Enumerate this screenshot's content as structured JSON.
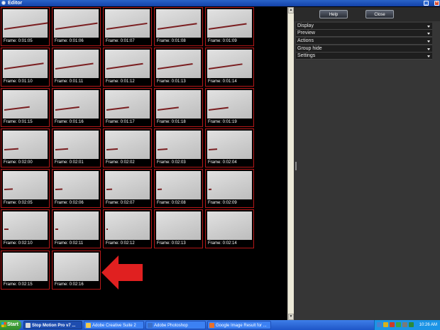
{
  "window": {
    "title": "Editor",
    "controls": {
      "minimize": "_",
      "maximize": "□",
      "close": "×"
    }
  },
  "frames": [
    {
      "label": "Frame: 0:01:05"
    },
    {
      "label": "Frame: 0:01:06"
    },
    {
      "label": "Frame: 0:01:07"
    },
    {
      "label": "Frame: 0:01:08"
    },
    {
      "label": "Frame: 0:01:09"
    },
    {
      "label": "Frame: 0:01:10"
    },
    {
      "label": "Frame: 0:01:11"
    },
    {
      "label": "Frame: 0:01:12"
    },
    {
      "label": "Frame: 0:01:13"
    },
    {
      "label": "Frame: 0:01:14"
    },
    {
      "label": "Frame: 0:01:15"
    },
    {
      "label": "Frame: 0:01:16"
    },
    {
      "label": "Frame: 0:01:17"
    },
    {
      "label": "Frame: 0:01:18"
    },
    {
      "label": "Frame: 0:01:19"
    },
    {
      "label": "Frame: 0:02:00"
    },
    {
      "label": "Frame: 0:02:01"
    },
    {
      "label": "Frame: 0:02:02"
    },
    {
      "label": "Frame: 0:02:03"
    },
    {
      "label": "Frame: 0:02:04"
    },
    {
      "label": "Frame: 0:02:05"
    },
    {
      "label": "Frame: 0:02:06"
    },
    {
      "label": "Frame: 0:02:07"
    },
    {
      "label": "Frame: 0:02:08"
    },
    {
      "label": "Frame: 0:02:09"
    },
    {
      "label": "Frame: 0:02:10"
    },
    {
      "label": "Frame: 0:02:11"
    },
    {
      "label": "Frame: 0:02:12"
    },
    {
      "label": "Frame: 0:02:13"
    },
    {
      "label": "Frame: 0:02:14"
    },
    {
      "label": "Frame: 0:02:15"
    },
    {
      "label": "Frame: 0:02:16"
    }
  ],
  "annotation": {
    "arrow_color": "#e02020"
  },
  "panel": {
    "buttons": {
      "help": "Help",
      "close": "Close"
    },
    "menus": [
      "Display",
      "Preview",
      "Actions",
      "Group hide",
      "Settings"
    ]
  },
  "taskbar": {
    "start": "Start",
    "tasks": [
      {
        "label": "Stop Motion Pro v7 ...",
        "icon_color": "#d8d8d8"
      },
      {
        "label": "Adobe Creative Suite 2",
        "icon_color": "#f2c94c"
      },
      {
        "label": "Adobe Photoshop",
        "icon_color": "#3a6fc9"
      },
      {
        "label": "Google Image Result for ...",
        "icon_color": "#e8702a"
      }
    ],
    "clock": "10:26 AM"
  }
}
